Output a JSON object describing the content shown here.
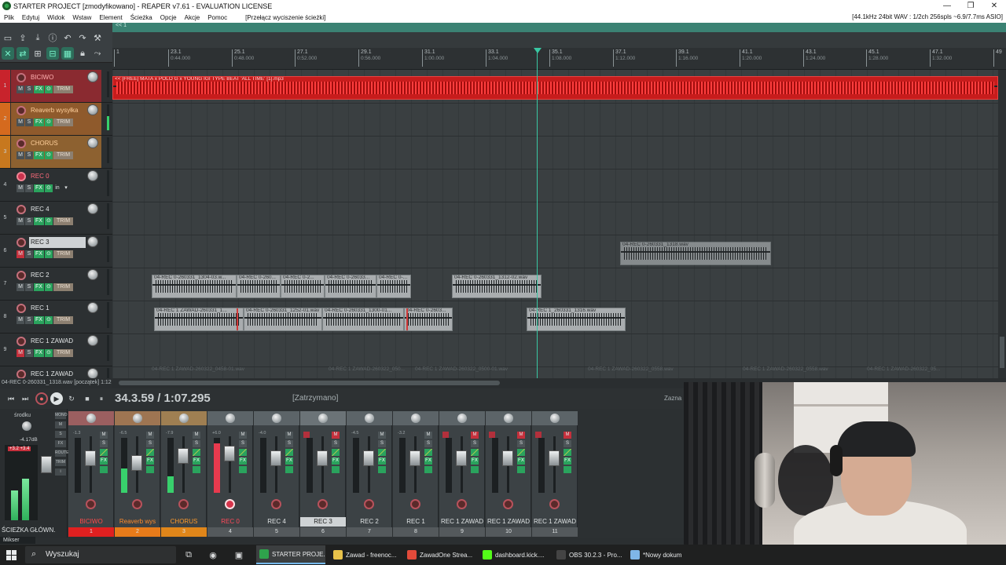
{
  "window": {
    "title": "STARTER PROJECT [zmodyfikowano] - REAPER v7.61 - EVALUATION LICENSE",
    "controls": [
      "—",
      "❐",
      "✕"
    ]
  },
  "menu": {
    "items": [
      "Plik",
      "Edytuj",
      "Widok",
      "Wstaw",
      "Element",
      "Ścieżka",
      "Opcje",
      "Akcje",
      "Pomoc"
    ],
    "action": "[Przełącz wyciszenie ścieżki]",
    "audio_status": "[44.1kHz 24bit WAV : 1/2ch 256spls ~6.9/7.7ms ASIO]"
  },
  "region_bar": {
    "label": "<< 1"
  },
  "ruler": {
    "marks": [
      {
        "bar": "1",
        "time": ""
      },
      {
        "bar": "23.1",
        "time": "0:44.000"
      },
      {
        "bar": "25.1",
        "time": "0:48.000"
      },
      {
        "bar": "27.1",
        "time": "0:52.000"
      },
      {
        "bar": "29.1",
        "time": "0:56.000"
      },
      {
        "bar": "31.1",
        "time": "1:00.000"
      },
      {
        "bar": "33.1",
        "time": "1:04.000"
      },
      {
        "bar": "35.1",
        "time": "1:08.000"
      },
      {
        "bar": "37.1",
        "time": "1:12.000"
      },
      {
        "bar": "39.1",
        "time": "1:16.000"
      },
      {
        "bar": "41.1",
        "time": "1:20.000"
      },
      {
        "bar": "43.1",
        "time": "1:24.000"
      },
      {
        "bar": "45.1",
        "time": "1:28.000"
      },
      {
        "bar": "47.1",
        "time": "1:32.000"
      },
      {
        "bar": "49",
        "time": ""
      }
    ]
  },
  "tracks": [
    {
      "num": "1",
      "name": "BICIWO",
      "color": "#c8232c",
      "armed": false,
      "mute": false,
      "io": "",
      "meter": 0
    },
    {
      "num": "2",
      "name": "Reaverb wysyłka",
      "color": "#d56a1e",
      "armed": false,
      "mute": false,
      "io": "",
      "meter": 0.55
    },
    {
      "num": "3",
      "name": "CHORUS",
      "color": "#c7781e",
      "armed": false,
      "mute": false,
      "io": "",
      "meter": 0
    },
    {
      "num": "4",
      "name": "REC 0",
      "color": "",
      "armed": true,
      "mute": false,
      "io": "in",
      "meter": 0
    },
    {
      "num": "5",
      "name": "REC 4",
      "color": "",
      "armed": false,
      "mute": false,
      "io": "",
      "meter": 0
    },
    {
      "num": "6",
      "name": "REC 3",
      "color": "",
      "armed": false,
      "mute": true,
      "io": "",
      "meter": 0
    },
    {
      "num": "7",
      "name": "REC 2",
      "color": "",
      "armed": false,
      "mute": false,
      "io": "",
      "meter": 0
    },
    {
      "num": "8",
      "name": "REC 1",
      "color": "",
      "armed": false,
      "mute": false,
      "io": "",
      "meter": 0
    },
    {
      "num": "9",
      "name": "REC 1 ZAWAD",
      "color": "",
      "armed": false,
      "mute": true,
      "io": "",
      "meter": 0
    },
    {
      "num": "",
      "name": "REC 1 ZAWAD",
      "color": "",
      "armed": false,
      "mute": false,
      "io": "",
      "meter": 0
    }
  ],
  "track_buttons": {
    "mute": "M",
    "solo": "S",
    "fx": "FX",
    "io": "⊙",
    "trim": "TRIM",
    "in_label": "in"
  },
  "items": [
    {
      "track": 0,
      "label": "<< [FREE] MATA x POLO G x YOUNG IGI TYPE BEAT 'ALL TIME' [1].mp3",
      "red": true
    },
    {
      "track": 5,
      "label": "04-REC 0-260331_1318.wav",
      "red": false
    },
    {
      "track": 6,
      "label": "04-REC 0-260331_1304-03.w...",
      "red": false
    },
    {
      "track": 6,
      "label": "04-REC 0-260...",
      "red": false
    },
    {
      "track": 6,
      "label": "04-REC 0-2...",
      "red": false
    },
    {
      "track": 6,
      "label": "04-REC 0-26033...",
      "red": false
    },
    {
      "track": 6,
      "label": "04-REC 0-...",
      "red": false
    },
    {
      "track": 6,
      "label": "04-REC 0-260331_1312-02.wav",
      "red": false
    },
    {
      "track": 7,
      "label": "04-REC 1 ZAWAD-260331_1...",
      "red": false
    },
    {
      "track": 7,
      "label": "04-REC 0-260331_1252-01.wav",
      "red": false
    },
    {
      "track": 7,
      "label": "04-REC 0-260331_1300-01...",
      "red": false
    },
    {
      "track": 7,
      "label": "04-REC 0-2603...",
      "red": false
    },
    {
      "track": 7,
      "label": "04-REC 1_260331_1316.wav",
      "red": false
    }
  ],
  "ghost_labels": [
    "04-REC 1 ZAWAD-260322_0458-01.wav",
    "04-REC 1 ZAWAD-260322_050...",
    "04-REC 1 ZAWAD-260322_0500-01.wav",
    "04-REC 1 ZAWAD-260322_0558.wav",
    "04-REC 1 ZAWAD-260322_0558.wav",
    "04-REC 1 ZAWAD-260322_05..."
  ],
  "status_line": "04-REC 0-260331_1318.wav [początek] 1:12",
  "transport": {
    "buttons": [
      "⏮",
      "⏭",
      "●",
      "▶",
      "↻",
      "■",
      "⏸"
    ],
    "position": "34.3.59 / 1:07.295",
    "state": "[Zatrzymano]",
    "zazna": "Zazna"
  },
  "master": {
    "title": "środku",
    "db": "-4.17dB",
    "peak": "+3.2 +3.4",
    "name": "ŚCIEŻKA GŁÓWN.",
    "side_buttons": [
      "MONO",
      "M",
      "S",
      "FX",
      "ROUTE",
      "TRIM",
      "i"
    ],
    "meter_levels": [
      0.4,
      0.55
    ]
  },
  "mixer_tab": "Mikser",
  "strips": [
    {
      "name": "BICIWO",
      "num": "1",
      "num_color": "#e02020",
      "name_color": "#ff4a4a",
      "top_color": "#9b5f60",
      "mute": false,
      "armed": false,
      "db": "-1.3",
      "meter": 0,
      "fader_pos": 0.3
    },
    {
      "name": "Reaverb wys",
      "num": "2",
      "num_color": "#e77b1a",
      "name_color": "#ff8a2a",
      "top_color": "#9e7552",
      "mute": false,
      "armed": false,
      "db": "-6.5",
      "meter": 0.45,
      "fader_pos": 0.4
    },
    {
      "name": "CHORUS",
      "num": "3",
      "num_color": "#e0861a",
      "name_color": "#ff9a2a",
      "top_color": "#9f7f52",
      "mute": false,
      "armed": false,
      "db": "-7.9",
      "meter": 0.3,
      "fader_pos": 0.25
    },
    {
      "name": "REC 0",
      "num": "4",
      "num_color": "#54595c",
      "name_color": "#ff4a5a",
      "top_color": "#5c6468",
      "mute": false,
      "armed": true,
      "db": "+6.0",
      "meter": 0.9,
      "fader_pos": 0.2
    },
    {
      "name": "REC 4",
      "num": "5",
      "num_color": "#54595c",
      "name_color": "",
      "top_color": "#5c6468",
      "mute": false,
      "armed": false,
      "db": "-4.0",
      "meter": 0,
      "fader_pos": 0.3
    },
    {
      "name": "REC 3",
      "num": "6",
      "num_color": "#54595c",
      "name_color": "",
      "top_color": "#6b7377",
      "mute": true,
      "armed": false,
      "db": "",
      "meter": 0,
      "fader_pos": 0.3,
      "selected": true
    },
    {
      "name": "REC 2",
      "num": "7",
      "num_color": "#54595c",
      "name_color": "",
      "top_color": "#5c6468",
      "mute": false,
      "armed": false,
      "db": "-4.5",
      "meter": 0,
      "fader_pos": 0.3
    },
    {
      "name": "REC 1",
      "num": "8",
      "num_color": "#54595c",
      "name_color": "",
      "top_color": "#5c6468",
      "mute": false,
      "armed": false,
      "db": "-3.2",
      "meter": 0,
      "fader_pos": 0.3
    },
    {
      "name": "REC 1 ZAWAD",
      "num": "9",
      "num_color": "#54595c",
      "name_color": "",
      "top_color": "#5c6468",
      "mute": true,
      "armed": false,
      "db": "",
      "meter": 0,
      "fader_pos": 0.3
    },
    {
      "name": "REC 1 ZAWAD",
      "num": "10",
      "num_color": "#54595c",
      "name_color": "",
      "top_color": "#5c6468",
      "mute": true,
      "armed": false,
      "db": "",
      "meter": 0,
      "fader_pos": 0.3
    },
    {
      "name": "REC 1 ZAWAD",
      "num": "11",
      "num_color": "#54595c",
      "name_color": "",
      "top_color": "#5c6468",
      "mute": true,
      "armed": false,
      "db": "",
      "meter": 0,
      "fader_pos": 0.3
    }
  ],
  "strip_buttons": {
    "mute": "M",
    "solo": "S",
    "fx": "FX"
  },
  "taskbar": {
    "search_placeholder": "Wyszukaj",
    "apps": [
      {
        "label": "STARTER PROJE...",
        "color": "#2fa34c",
        "active": true
      },
      {
        "label": "Zawad - freenoc...",
        "color": "#e8c24a",
        "active": false
      },
      {
        "label": "ZawadOne Strea...",
        "color": "#e24a3a",
        "active": false
      },
      {
        "label": "dashboard.kick....",
        "color": "#53fc18",
        "active": false
      },
      {
        "label": "OBS 30.2.3 - Pro...",
        "color": "#444444",
        "active": false
      },
      {
        "label": "*Nowy dokum",
        "color": "#7fb6e8",
        "active": false
      }
    ]
  }
}
